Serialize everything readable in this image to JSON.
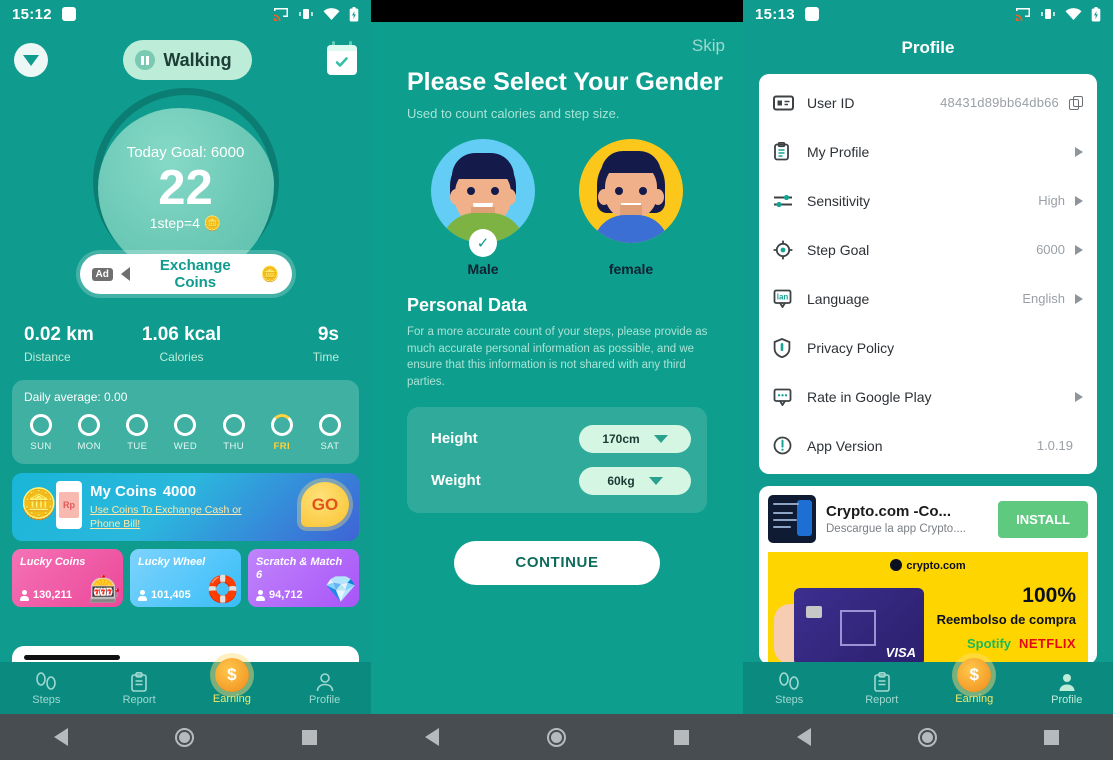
{
  "screen1": {
    "status": {
      "time": "15:12",
      "icons": [
        "cast-icon",
        "vibrate-icon",
        "wifi-icon",
        "battery-icon"
      ]
    },
    "header": {
      "dropdown_icon": "chevron-down-icon",
      "mode_label": "Walking",
      "mode_icon": "pause-icon",
      "calendar_icon": "calendar-check-icon"
    },
    "dial": {
      "goal_label": "Today Goal: 6000",
      "steps": "22",
      "rate": "1step=4",
      "rate_icon": "coin-icon"
    },
    "exchange": {
      "ad_badge": "Ad",
      "speaker_icon": "speaker-icon",
      "label": "Exchange Coins",
      "coin_icon": "coin-icon"
    },
    "metrics": [
      {
        "value": "0.02 km",
        "label": "Distance"
      },
      {
        "value": "1.06 kcal",
        "label": "Calories"
      },
      {
        "value": "9s",
        "label": "Time"
      }
    ],
    "week": {
      "daily_average": "Daily average: 0.00",
      "days": [
        {
          "name": "SUN",
          "active": false
        },
        {
          "name": "MON",
          "active": false
        },
        {
          "name": "TUE",
          "active": false
        },
        {
          "name": "WED",
          "active": false
        },
        {
          "name": "THU",
          "active": false
        },
        {
          "name": "FRI",
          "active": true
        },
        {
          "name": "SAT",
          "active": false
        }
      ]
    },
    "coins_banner": {
      "title": "My Coins",
      "amount": "4000",
      "subtitle": "Use Coins To Exchange Cash or Phone Bill!",
      "cta": "GO",
      "phone_label": "Rp"
    },
    "tiles": [
      {
        "title": "Lucky Coins",
        "count": "130,211",
        "art": "🎰"
      },
      {
        "title": "Lucky Wheel",
        "count": "101,405",
        "art": "🛟"
      },
      {
        "title": "Scratch\n& Match 6",
        "count": "94,712",
        "art": "💎"
      }
    ],
    "nav": [
      {
        "label": "Steps",
        "icon": "footsteps-icon",
        "state": "inactive"
      },
      {
        "label": "Report",
        "icon": "clipboard-icon",
        "state": "inactive"
      },
      {
        "label": "Earning",
        "icon": "coin-dollar-icon",
        "state": "highlight"
      },
      {
        "label": "Profile",
        "icon": "person-icon",
        "state": "inactive"
      }
    ],
    "sysnav": [
      "back-icon",
      "home-icon",
      "recents-icon"
    ]
  },
  "screen2": {
    "skip": "Skip",
    "title": "Please Select Your Gender",
    "subtitle": "Used to count calories and step size.",
    "genders": [
      {
        "label": "Male",
        "selected": true
      },
      {
        "label": "female",
        "selected": false
      }
    ],
    "section_title": "Personal Data",
    "section_text": "For a more accurate count of your steps, please provide as much accurate personal information as possible, and we ensure that this information is not shared with any third parties.",
    "fields": [
      {
        "label": "Height",
        "value": "170cm"
      },
      {
        "label": "Weight",
        "value": "60kg"
      }
    ],
    "continue_label": "CONTINUE",
    "sysnav": [
      "back-icon",
      "home-icon",
      "recents-icon"
    ]
  },
  "screen3": {
    "status": {
      "time": "15:13",
      "icons": [
        "cast-icon",
        "vibrate-icon",
        "wifi-icon",
        "battery-icon"
      ]
    },
    "title": "Profile",
    "settings": [
      {
        "name": "User ID",
        "value": "48431d89bb64db66",
        "icon": "id-card-icon",
        "trailing": "copy-icon"
      },
      {
        "name": "My Profile",
        "value": "",
        "icon": "clipboard-icon",
        "trailing": "arrow-icon"
      },
      {
        "name": "Sensitivity",
        "value": "High",
        "icon": "sliders-icon",
        "trailing": "arrow-icon"
      },
      {
        "name": "Step Goal",
        "value": "6000",
        "icon": "target-icon",
        "trailing": "arrow-icon"
      },
      {
        "name": "Language",
        "value": "English",
        "icon": "language-icon",
        "trailing": "arrow-icon"
      },
      {
        "name": "Privacy Policy",
        "value": "",
        "icon": "shield-icon",
        "trailing": "none"
      },
      {
        "name": "Rate in Google Play",
        "value": "",
        "icon": "comment-icon",
        "trailing": "arrow-icon"
      },
      {
        "name": "App Version",
        "value": "1.0.19",
        "icon": "info-icon",
        "trailing": "none"
      }
    ],
    "ad": {
      "title": "Crypto.com -Co...",
      "description": "Descargue la app Crypto....",
      "install_label": "INSTALL",
      "banner_brand": "crypto.com",
      "banner_headline": "100%",
      "banner_sub": "Reembolso de compra",
      "banner_brand1": "Spotify",
      "banner_brand2": "NETFLIX",
      "card_network": "VISA"
    },
    "nav": [
      {
        "label": "Steps",
        "icon": "footsteps-icon",
        "state": "inactive"
      },
      {
        "label": "Report",
        "icon": "clipboard-icon",
        "state": "inactive"
      },
      {
        "label": "Earning",
        "icon": "coin-dollar-icon",
        "state": "highlight"
      },
      {
        "label": "Profile",
        "icon": "person-icon",
        "state": "active"
      }
    ],
    "sysnav": [
      "back-icon",
      "home-icon",
      "recents-icon"
    ]
  },
  "colors": {
    "brand": "#0f9b8e",
    "nav": "#0b8b80",
    "accent_yellow": "#ffd23f",
    "ad_yellow": "#ffd500",
    "install_green": "#5ec97f"
  }
}
